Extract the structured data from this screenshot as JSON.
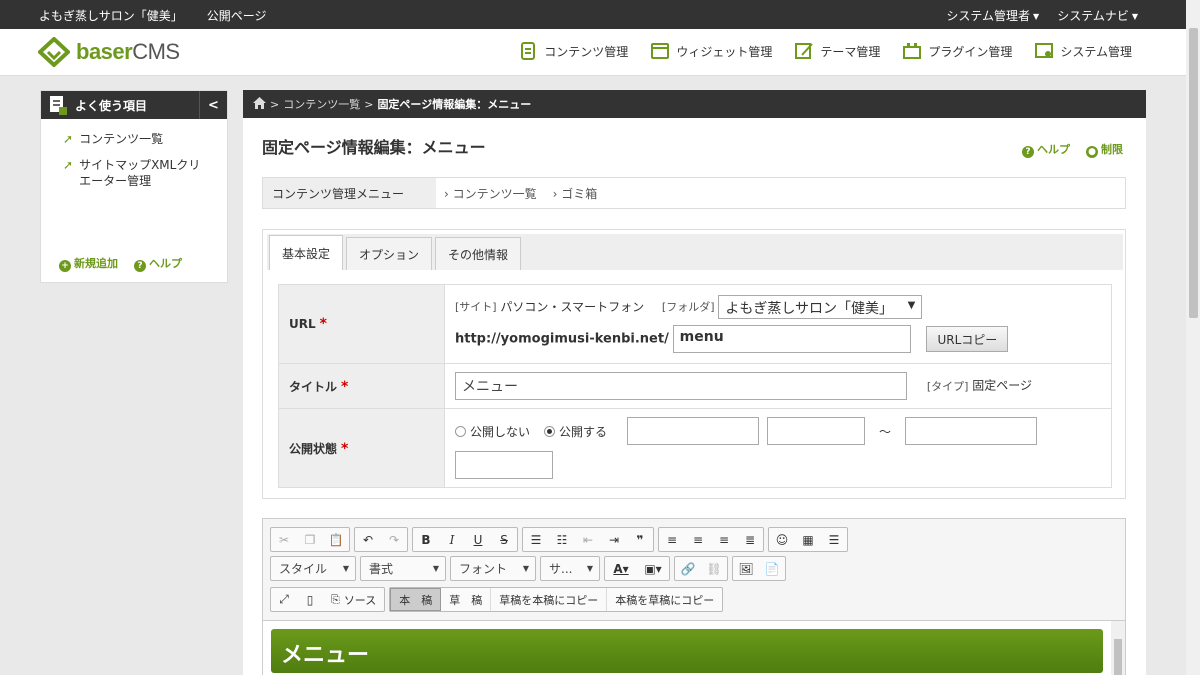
{
  "topbar": {
    "site_name": "よもぎ蒸しサロン「健美」",
    "public_page": "公開ページ",
    "sys_admin": "システム管理者",
    "sys_nav": "システムナビ"
  },
  "logo": {
    "brand": "baser",
    "suffix": "CMS"
  },
  "nav": [
    {
      "label": "コンテンツ管理",
      "icon": "contents-icon"
    },
    {
      "label": "ウィジェット管理",
      "icon": "widget-icon"
    },
    {
      "label": "テーマ管理",
      "icon": "theme-icon"
    },
    {
      "label": "プラグイン管理",
      "icon": "plugin-icon"
    },
    {
      "label": "システム管理",
      "icon": "system-icon"
    }
  ],
  "sidebar": {
    "title": "よく使う項目",
    "collapse": "<",
    "items": [
      {
        "label": "コンテンツ一覧"
      },
      {
        "label": "サイトマップXMLクリエーター管理"
      }
    ],
    "add": "新規追加",
    "help": "ヘルプ"
  },
  "breadcrumb": {
    "sep": ">",
    "item1": "コンテンツ一覧",
    "current": "固定ページ情報編集：メニュー"
  },
  "page": {
    "title": "固定ページ情報編集：メニュー",
    "help": "ヘルプ",
    "restrict": "制限"
  },
  "content_menu": {
    "label": "コンテンツ管理メニュー",
    "links": [
      "コンテンツ一覧",
      "ゴミ箱"
    ]
  },
  "tabs": [
    {
      "label": "基本設定"
    },
    {
      "label": "オプション"
    },
    {
      "label": "その他情報"
    }
  ],
  "form": {
    "url_label": "URL",
    "site_label": "[サイト]",
    "site_value": "パソコン・スマートフォン",
    "folder_label": "[フォルダ]",
    "folder_value": "よもぎ蒸しサロン「健美」",
    "url_prefix": "http://yomogimusi-kenbi.net/",
    "url_value": "menu",
    "url_copy": "URLコピー",
    "title_label": "タイトル",
    "title_value": "メニュー",
    "type_label": "[タイプ]",
    "type_value": "固定ページ",
    "status_label": "公開状態",
    "status_off": "公開しない",
    "status_on": "公開する",
    "tilde": "～",
    "required": "*"
  },
  "editor": {
    "style": "スタイル",
    "format": "書式",
    "font": "フォント",
    "size": "サ...",
    "source": "ソース",
    "main_draft": "本　稿",
    "draft": "草　稿",
    "copy_draft_to_main": "草稿を本稿にコピー",
    "copy_main_to_draft": "本稿を草稿にコピー",
    "heading": "メニュー"
  },
  "colors": {
    "accent": "#6d9a1c",
    "dark": "#333333"
  }
}
